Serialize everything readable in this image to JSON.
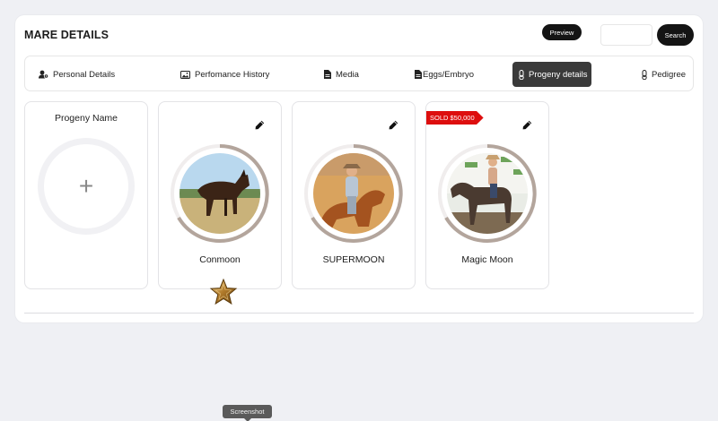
{
  "header": {
    "title": "MARE DETAILS",
    "preview_label": "Preview",
    "search_label": "Search",
    "search_value": "",
    "search_placeholder": ""
  },
  "tabs": [
    {
      "label": "Personal Details",
      "icon": "person-gear-icon",
      "active": false
    },
    {
      "label": "Perfomance History",
      "icon": "image-icon",
      "active": false
    },
    {
      "label": "Media",
      "icon": "document-icon",
      "active": false
    },
    {
      "label": "Eggs/Embryo",
      "icon": "document-icon",
      "active": false
    },
    {
      "label": "Progeny details",
      "icon": "thermometer-icon",
      "active": true
    },
    {
      "label": "Pedigree",
      "icon": "thermometer-icon",
      "active": false
    }
  ],
  "add_card": {
    "heading": "Progeny Name",
    "icon": "plus-icon"
  },
  "progeny": [
    {
      "name": "Conmoon",
      "sold_label": "",
      "has_star": true
    },
    {
      "name": "SUPERMOON",
      "sold_label": "",
      "has_star": false
    },
    {
      "name": "Magic Moon",
      "sold_label": "SOLD $50,000",
      "has_star": false
    }
  ],
  "tooltip": "Screenshot",
  "colors": {
    "accent": "#141414",
    "sold_badge": "#dd0e0e",
    "ring": "#b3a59c",
    "page_bg": "#eff0f4"
  }
}
